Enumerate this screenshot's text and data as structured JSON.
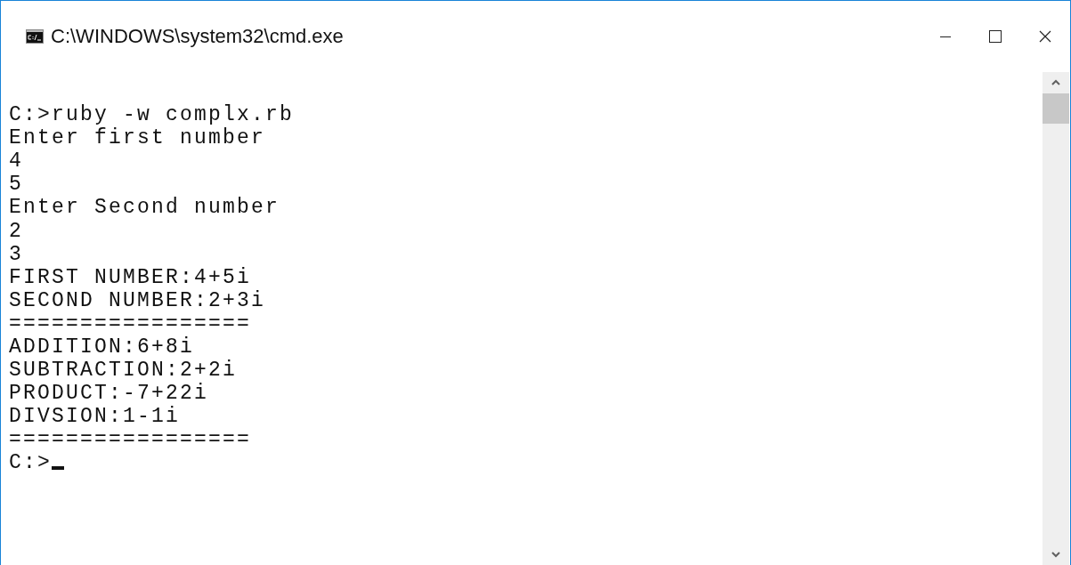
{
  "window": {
    "title": "C:\\WINDOWS\\system32\\cmd.exe"
  },
  "console": {
    "lines": [
      "C:>ruby -w complx.rb",
      "Enter first number",
      "4",
      "5",
      "Enter Second number",
      "2",
      "3",
      "FIRST NUMBER:4+5i",
      "SECOND NUMBER:2+3i",
      "=================",
      "ADDITION:6+8i",
      "SUBTRACTION:2+2i",
      "PRODUCT:-7+22i",
      "DIVSION:1-1i",
      "=================",
      "C:>"
    ]
  }
}
